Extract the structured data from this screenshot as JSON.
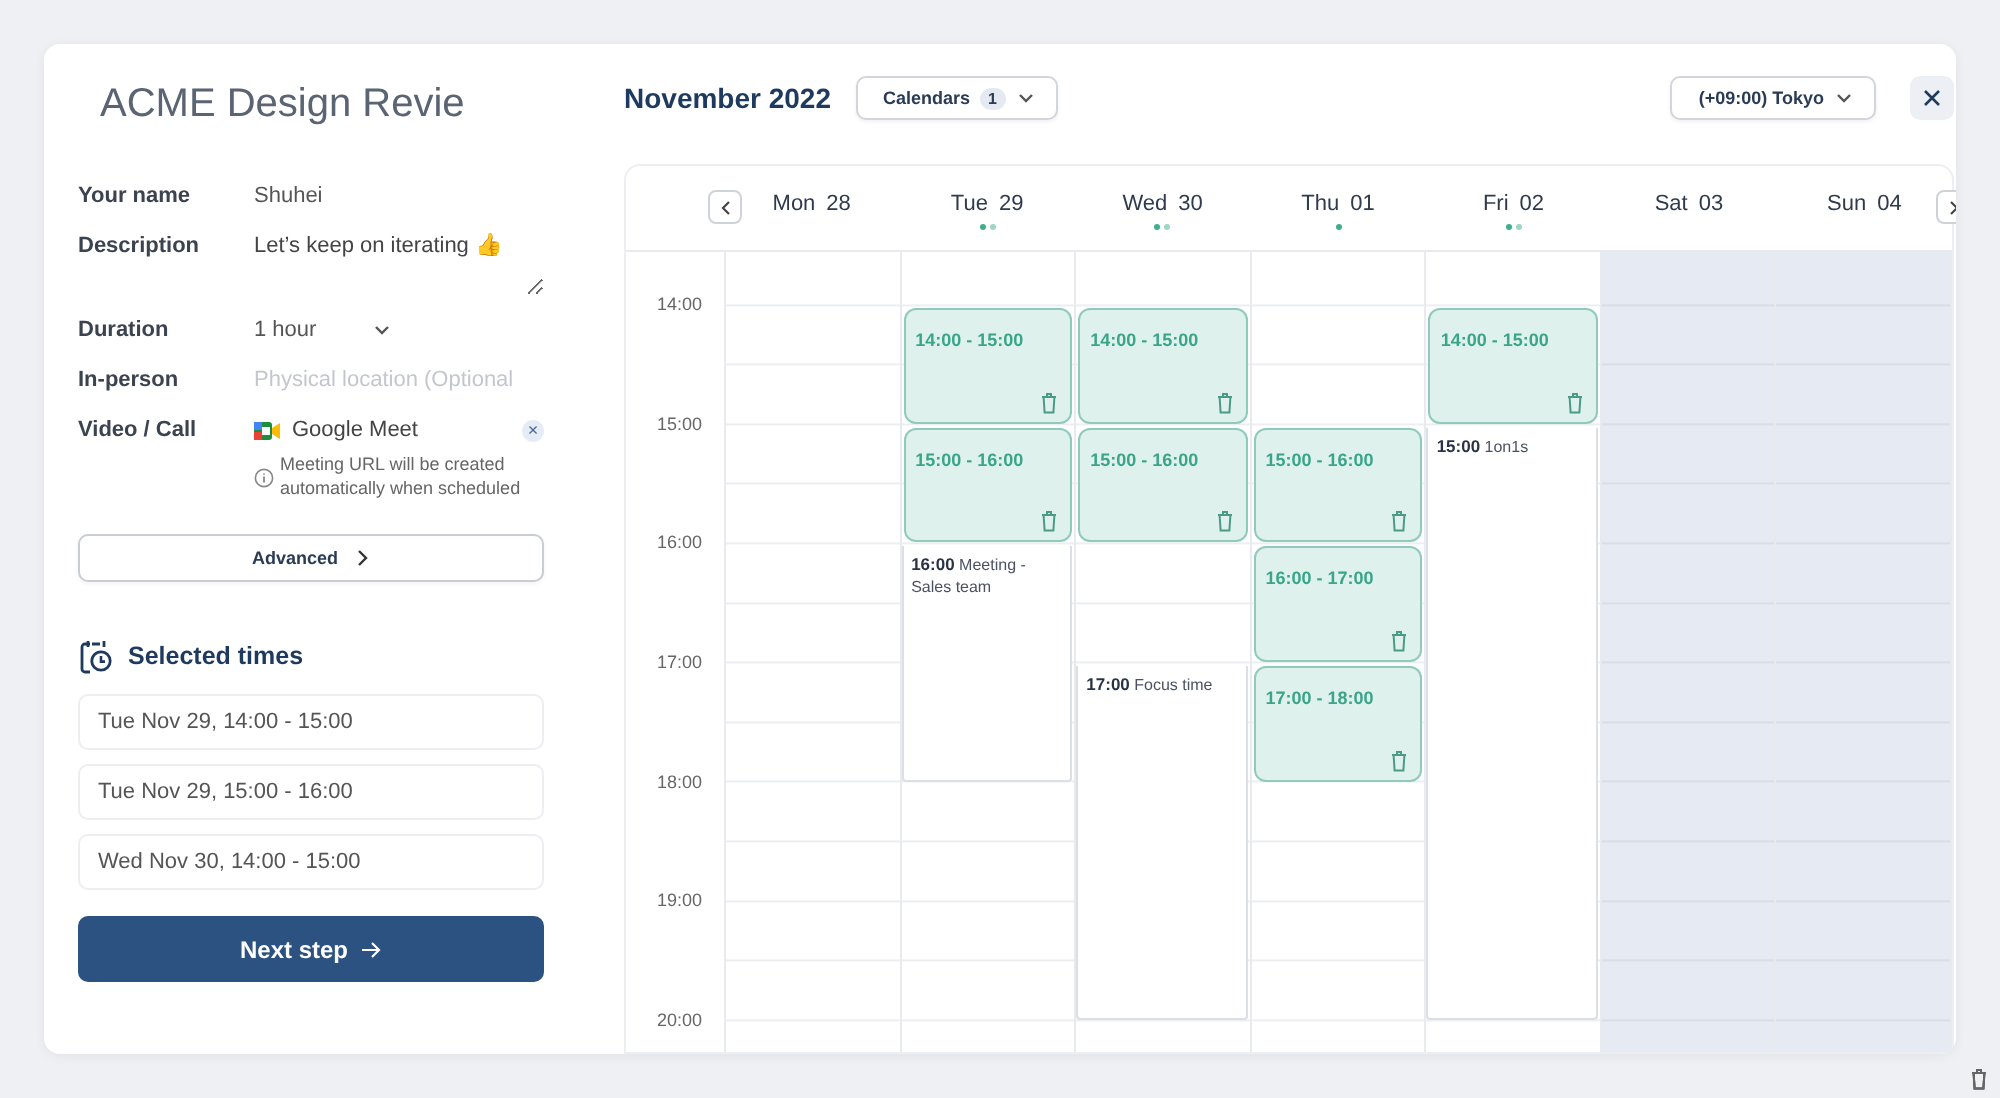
{
  "title_field": {
    "value": "ACME Design Revie"
  },
  "form": [
    {
      "kind": "text",
      "label": "Your name",
      "value": "Shuhei"
    },
    {
      "kind": "textarea",
      "label": "Description",
      "value": "Let’s keep on iterating 👍"
    },
    {
      "kind": "select",
      "label": "Duration",
      "value": "1 hour"
    },
    {
      "kind": "text",
      "label": "In-person",
      "placeholder": "Physical location (Optional"
    },
    {
      "kind": "video",
      "label": "Video / Call",
      "value": "Google Meet",
      "remove_label": "×",
      "note": "Meeting URL will be created automatically when scheduled"
    }
  ],
  "advanced_button": "Advanced",
  "selected_times": {
    "heading": "Selected times",
    "items": [
      "Tue Nov 29, 14:00 - 15:00",
      "Tue Nov 29, 15:00 - 16:00",
      "Wed Nov 30, 14:00 - 15:00"
    ]
  },
  "next_button": "Next step",
  "month": "November 2022",
  "calendars_button": {
    "label": "Calendars",
    "count": "1"
  },
  "timezone": "(+09:00) Tokyo",
  "times": [
    "14:00",
    "15:00",
    "16:00",
    "17:00",
    "18:00",
    "19:00",
    "20:00"
  ],
  "days": [
    {
      "name": "Mon",
      "date": "28",
      "weekend": false
    },
    {
      "name": "Tue",
      "date": "29",
      "weekend": false,
      "dots": [
        {
          "color": "#3fae8c"
        },
        {
          "color": "#9fd6c3"
        }
      ],
      "events": [
        {
          "kind": "slot",
          "label": "14:00 - 15:00"
        },
        {
          "kind": "slot",
          "label": "15:00 - 16:00"
        },
        {
          "kind": "busy",
          "time": "16:00",
          "title": "Meeting - Sales team",
          "to_end": false
        }
      ]
    },
    {
      "name": "Wed",
      "date": "30",
      "weekend": false,
      "dots": [
        {
          "color": "#3fae8c"
        },
        {
          "color": "#9fd6c3"
        }
      ],
      "events": [
        {
          "kind": "slot",
          "label": "14:00 - 15:00"
        },
        {
          "kind": "slot",
          "label": "15:00 - 16:00"
        },
        {
          "kind": "busy",
          "time": "17:00",
          "title": "Focus time",
          "to_end": true
        }
      ]
    },
    {
      "name": "Thu",
      "date": "01",
      "weekend": false,
      "dots": [
        {
          "color": "#3fae8c"
        }
      ],
      "events": [
        {
          "kind": "slot",
          "label": "15:00 - 16:00"
        },
        {
          "kind": "slot",
          "label": "16:00 - 17:00"
        },
        {
          "kind": "slot",
          "label": "17:00 - 18:00"
        }
      ]
    },
    {
      "name": "Fri",
      "date": "02",
      "weekend": false,
      "dots": [
        {
          "color": "#3fae8c"
        },
        {
          "color": "#9fd6c3"
        }
      ],
      "events": [
        {
          "kind": "slot",
          "label": "14:00 - 15:00"
        },
        {
          "kind": "busy",
          "time": "15:00",
          "title": "1on1s",
          "to_end": true
        }
      ]
    },
    {
      "name": "Sat",
      "date": "03",
      "weekend": true
    },
    {
      "name": "Sun",
      "date": "04",
      "weekend": true
    }
  ]
}
